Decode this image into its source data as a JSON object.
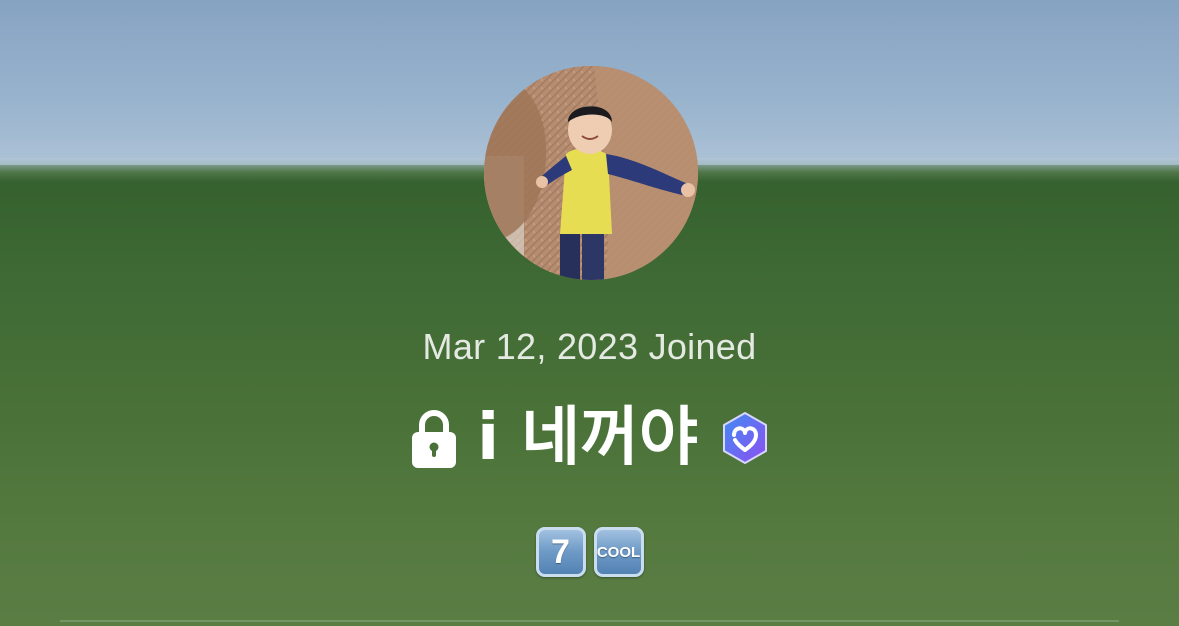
{
  "profile": {
    "joined": "Mar 12, 2023 Joined",
    "display_name": "i 네꺼야",
    "lock_icon": "lock-icon",
    "verified_icon": "verified-badge-icon",
    "badges": [
      {
        "icon": "keycap-seven-emoji",
        "label": "7"
      },
      {
        "icon": "cool-button-emoji",
        "label": "COOL"
      }
    ]
  },
  "colors": {
    "sky": "#98b3cd",
    "field": "#4a7238",
    "text": "#ffffff",
    "verified_gradient": [
      "#3f8cf3",
      "#8f4ef0"
    ],
    "badge_blue": "#6f9bc7"
  }
}
